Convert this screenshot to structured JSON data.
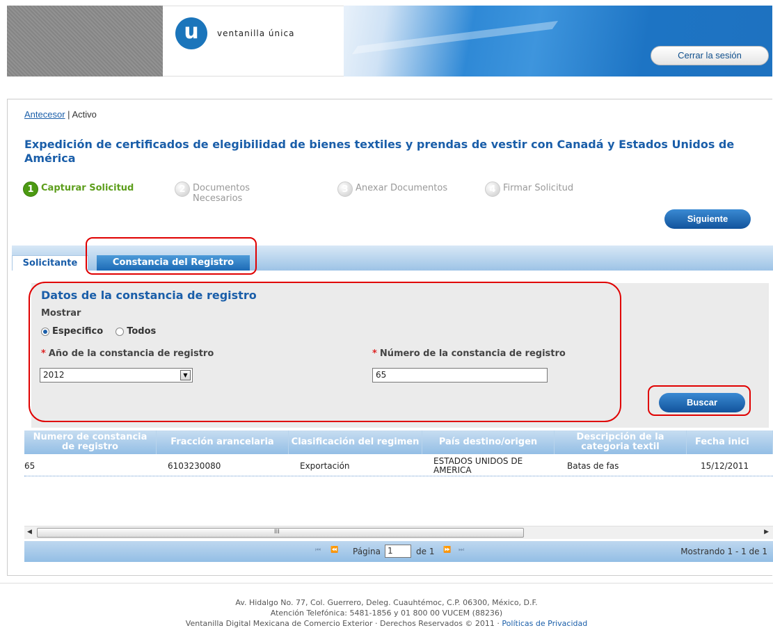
{
  "header": {
    "logo_letter": "u",
    "logo_text": "ventanilla única",
    "logout_label": "Cerrar la sesión"
  },
  "breadcrumb": {
    "link": "Antecesor",
    "separator": " | ",
    "current": "Activo"
  },
  "page_title": "Expedición de certificados de elegibilidad de bienes textiles y prendas de vestir con Canadá y Estados Unidos de América",
  "steps": [
    {
      "num": "1",
      "label": "Capturar Solicitud"
    },
    {
      "num": "2",
      "label": "Documentos Necesarios"
    },
    {
      "num": "3",
      "label": "Anexar Documentos"
    },
    {
      "num": "4",
      "label": "Firmar Solicitud"
    }
  ],
  "next_label": "Siguiente",
  "tabs": [
    {
      "label": "Solicitante"
    },
    {
      "label": "Constancia del Registro"
    }
  ],
  "form": {
    "title": "Datos de la constancia de registro",
    "mostrar_label": "Mostrar",
    "radio_specific": "Especifico",
    "radio_all": "Todos",
    "required_mark": "*",
    "year_label": "Año de la constancia de registro",
    "year_value": "2012",
    "number_label": "Número de la constancia de registro",
    "number_value": "65",
    "search_label": "Buscar"
  },
  "table": {
    "headers": [
      "Numero de constancia de registro",
      "Fracción arancelaria",
      "Clasificación del regimen",
      "País destino/origen",
      "Descripción de la categoria textil",
      "Fecha inici"
    ],
    "rows": [
      [
        "65",
        "6103230080",
        "Exportación",
        "ESTADOS UNIDOS DE AMERICA",
        "Batas de fas",
        "15/12/2011"
      ]
    ]
  },
  "scrollbar": {
    "grip": "III",
    "left_arrow": "◀",
    "right_arrow": "▶"
  },
  "pager": {
    "first": "⏮",
    "prev": "⏪",
    "page_label": "Página",
    "page_value": "1",
    "of_label": "de 1",
    "next": "⏩",
    "last": "⏭",
    "info": "Mostrando 1 - 1 de 1"
  },
  "footer": {
    "line1": "Av. Hidalgo No. 77, Col. Guerrero, Deleg. Cuauhtémoc, C.P. 06300, México, D.F.",
    "line2": "Atención Telefónica: 5481-1856 y 01 800 00 VUCEM (88236)",
    "line3": "Ventanilla Digital Mexicana de Comercio Exterior · Derechos Reservados © 2011 ·",
    "privacy_link": "Políticas de Privacidad"
  },
  "colors": {
    "brand_blue": "#1a5ea9",
    "active_step_green": "#5d9e1c",
    "highlight_red": "#e00000"
  }
}
